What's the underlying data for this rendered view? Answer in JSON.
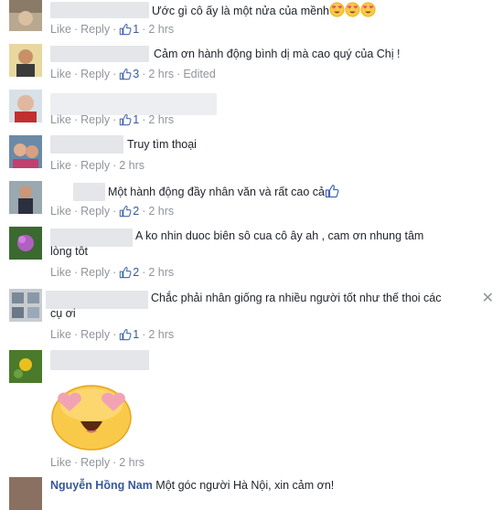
{
  "comments": [
    {
      "text": "Ước gì cô ấy là một nửa của mềnh",
      "like": "Like",
      "reply": "Reply",
      "likes": "1",
      "time": "2 hrs"
    },
    {
      "text": "Cảm ơn hành động bình dị mà cao quý của Chị !",
      "like": "Like",
      "reply": "Reply",
      "likes": "3",
      "time": "2 hrs",
      "edited": "Edited"
    },
    {
      "text": "",
      "like": "Like",
      "reply": "Reply",
      "likes": "1",
      "time": "2 hrs"
    },
    {
      "text": "Truy tìm thoại",
      "like": "Like",
      "reply": "Reply",
      "time": "2 hrs"
    },
    {
      "text": "Một hành động đầy nhân văn và rất cao cả",
      "like": "Like",
      "reply": "Reply",
      "likes": "2",
      "time": "2 hrs"
    },
    {
      "text_line1": "A ko nhin duoc biên sô cua cô ây ah , cam ơn nhung tâm",
      "text_line2": "lòng tôt",
      "like": "Like",
      "reply": "Reply",
      "likes": "2",
      "time": "2 hrs"
    },
    {
      "text_line1": "Chắc phải nhân giống ra nhiều người tốt như thế thoi các",
      "text_line2": "cụ ơi",
      "like": "Like",
      "reply": "Reply",
      "likes": "1",
      "time": "2 hrs",
      "close": "✕"
    },
    {
      "like": "Like",
      "reply": "Reply",
      "time": "2 hrs"
    },
    {
      "name": "Nguyễn Hồng Nam",
      "text": "Một góc người Hà Nội, xin cảm ơn!"
    }
  ],
  "colors": {
    "link": "#365899",
    "meta": "#90949c",
    "text": "#1d2129",
    "blur": "#e4e6ea"
  }
}
